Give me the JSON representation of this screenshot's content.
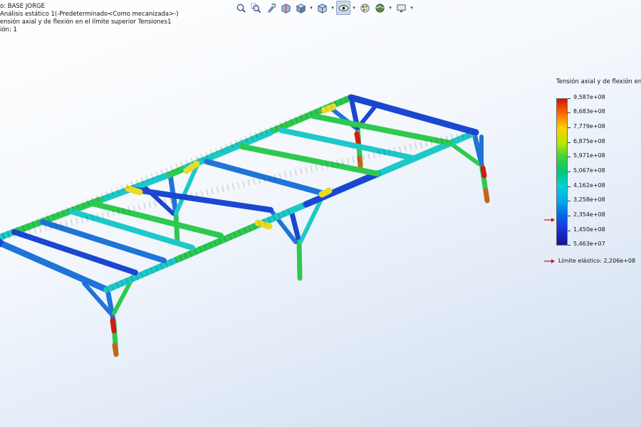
{
  "info": {
    "model_line": "o: BASE JORGE",
    "study_line": "Análisis estático 1(-Predeterminado<Como mecanizada>-)",
    "plot_line": "ensión axial y de flexión en el límite superior Tensiones1",
    "deformation_line": "ión: 1"
  },
  "toolbar": {
    "icons": [
      "zoom-to-fit-icon",
      "zoom-area-icon",
      "previous-view-icon",
      "section-view-icon",
      "view-orientation-icon",
      "display-style-icon",
      "hide-show-icon",
      "edit-appearance-icon",
      "apply-scene-icon",
      "view-settings-icon"
    ]
  },
  "legend": {
    "title": "Tensión axial y de flexión en el lí",
    "ticks": [
      "9,587e+08",
      "8,683e+08",
      "7,779e+08",
      "6,875e+08",
      "5,971e+08",
      "5,067e+08",
      "4,162e+08",
      "3,258e+08",
      "2,354e+08",
      "1,450e+08",
      "5,463e+07"
    ],
    "yield_label": "Límite elástico: 2,206e+08",
    "marker_color": "#cc1010"
  }
}
